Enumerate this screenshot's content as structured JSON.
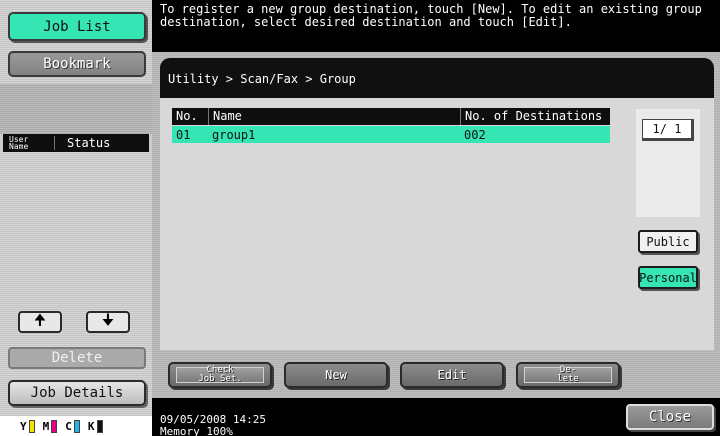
{
  "left_panel": {
    "job_list": "Job List",
    "bookmark": "Bookmark",
    "col_user_name_line1": "User",
    "col_user_name_line2": "Name",
    "col_status": "Status",
    "up_glyph": "🠉",
    "down_glyph": "🠋",
    "delete": "Delete",
    "job_details": "Job Details",
    "toner": [
      {
        "label": "Y",
        "color": "#f2e600"
      },
      {
        "label": "M",
        "color": "#e60087"
      },
      {
        "label": "C",
        "color": "#2bb3e8"
      },
      {
        "label": "K",
        "color": "#111111"
      }
    ]
  },
  "message": "To register a new group destination, touch [New]. To edit an existing group destination, select desired destination and touch [Edit].",
  "breadcrumb": "Utility > Scan/Fax > Group",
  "table": {
    "headers": [
      "No.",
      "Name",
      "No. of Destinations"
    ],
    "rows": [
      {
        "no": "01",
        "name": "group1",
        "count": "002"
      }
    ]
  },
  "pager": "1/  1",
  "tabs": {
    "public": "Public",
    "personal": "Personal"
  },
  "actions": {
    "check_set_line1": "Check",
    "check_set_line2": "Job Set.",
    "new": "New",
    "edit": "Edit",
    "delete_line1": "De-",
    "delete_line2": "lete"
  },
  "footer": {
    "datetime": "09/05/2008   14:25",
    "memory": "Memory      100%",
    "close": "Close"
  },
  "colors": {
    "accent": "#35e6b4"
  }
}
